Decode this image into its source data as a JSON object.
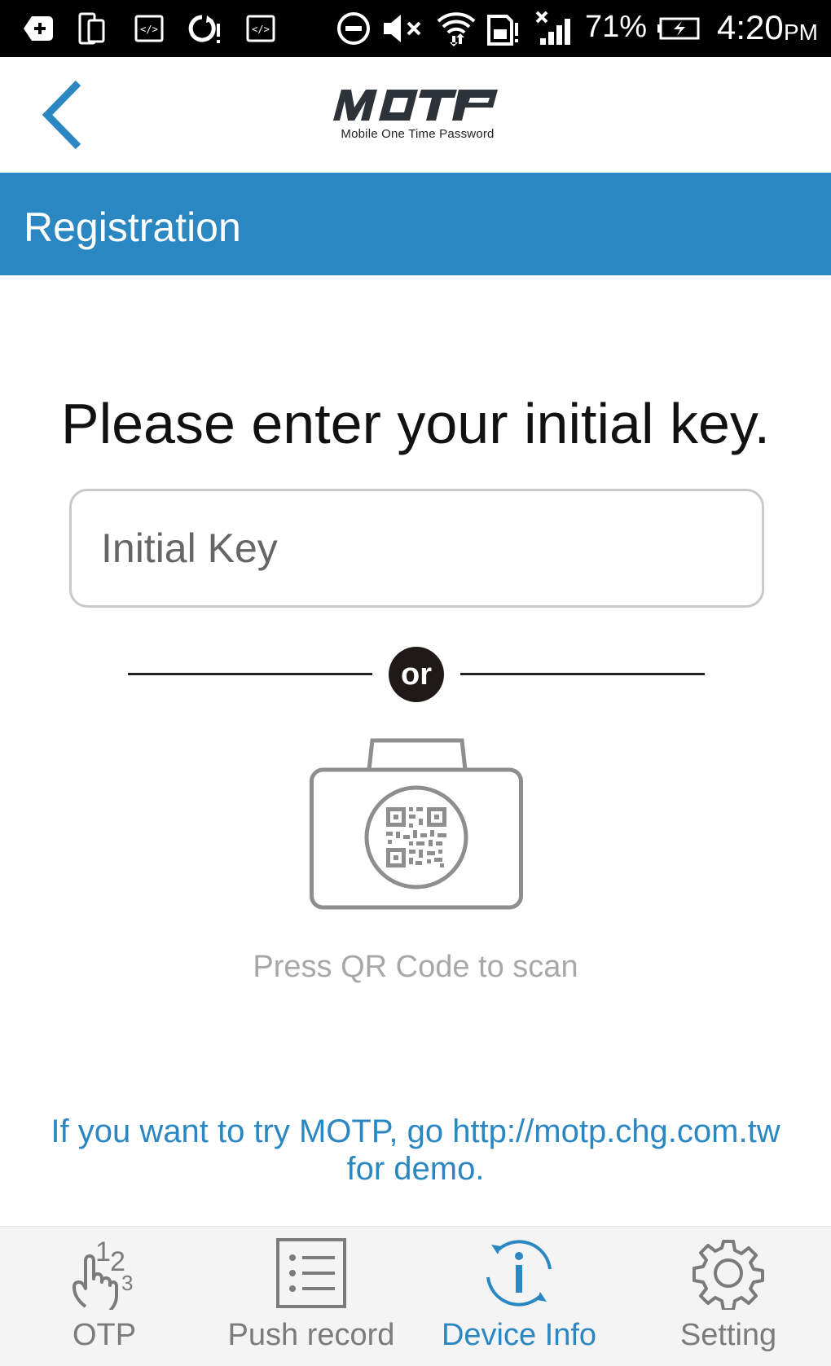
{
  "status_bar": {
    "battery_percent": "71%",
    "time": "4:20",
    "ampm": "PM",
    "icons": [
      "plus-square-icon",
      "device-rotate-icon",
      "code-icon",
      "sync-alert-icon",
      "code-icon",
      "dnd-icon",
      "mute-icon",
      "wifi-icon",
      "sd-alert-icon",
      "signal-icon",
      "battery-charging-icon"
    ]
  },
  "header": {
    "back_icon": "chevron-left-icon",
    "logo_text": "MOTP",
    "logo_subtitle": "Mobile One Time Password"
  },
  "title_band": {
    "title": "Registration"
  },
  "main": {
    "prompt": "Please enter your initial key.",
    "input": {
      "placeholder": "Initial Key",
      "value": ""
    },
    "or_label": "or",
    "qr_caption": "Press QR Code to scan",
    "demo_note": "If you want to try MOTP, go http://motp.chg.com.tw for demo."
  },
  "bottom_nav": {
    "items": [
      {
        "label": "OTP",
        "icon": "touch-123-icon",
        "active": false
      },
      {
        "label": "Push record",
        "icon": "list-icon",
        "active": false
      },
      {
        "label": "Device Info",
        "icon": "info-refresh-icon",
        "active": true
      },
      {
        "label": "Setting",
        "icon": "gear-icon",
        "active": false
      }
    ]
  },
  "colors": {
    "accent": "#2b87c2",
    "status_bar": "#000000",
    "text_dark": "#111111",
    "muted": "#a8a8a8",
    "nav_bg": "#f4f4f4"
  }
}
